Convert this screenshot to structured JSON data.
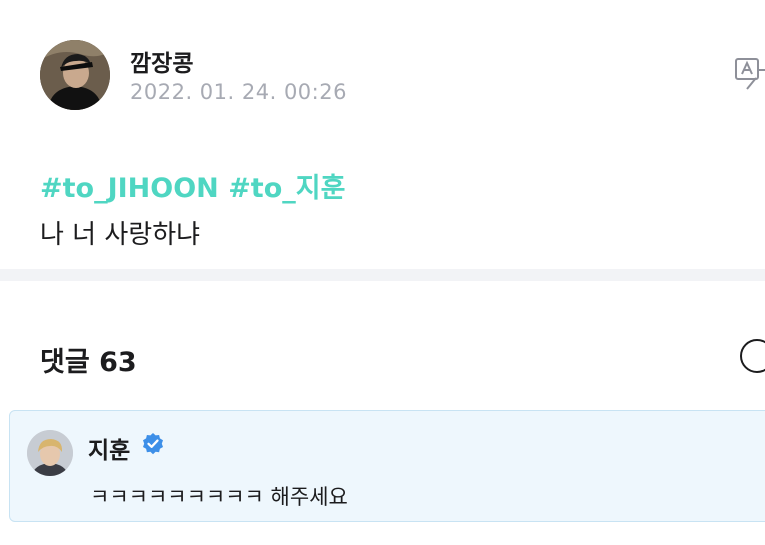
{
  "post": {
    "author": "깜장콩",
    "timestamp": "2022. 01. 24. 00:26",
    "hashtags": [
      "#to_JIHOON",
      "#to_지훈"
    ],
    "text": "나 너 사랑하냐"
  },
  "comments": {
    "title": "댓글 63",
    "items": [
      {
        "author": "지훈",
        "verified": true,
        "text": "ㅋㅋㅋㅋㅋㅋㅋㅋㅋ 해주세요"
      }
    ]
  },
  "colors": {
    "hashtag": "#4fd6c2",
    "timestamp": "#a7aab3",
    "verified": "#3d8fe8",
    "comment_bg": "#eef7fd",
    "comment_border": "#c8e3f3",
    "divider": "#f2f3f6"
  },
  "icons": {
    "translate": "translate-icon",
    "verified": "verified-badge-icon",
    "comment_action": "circle-icon"
  }
}
